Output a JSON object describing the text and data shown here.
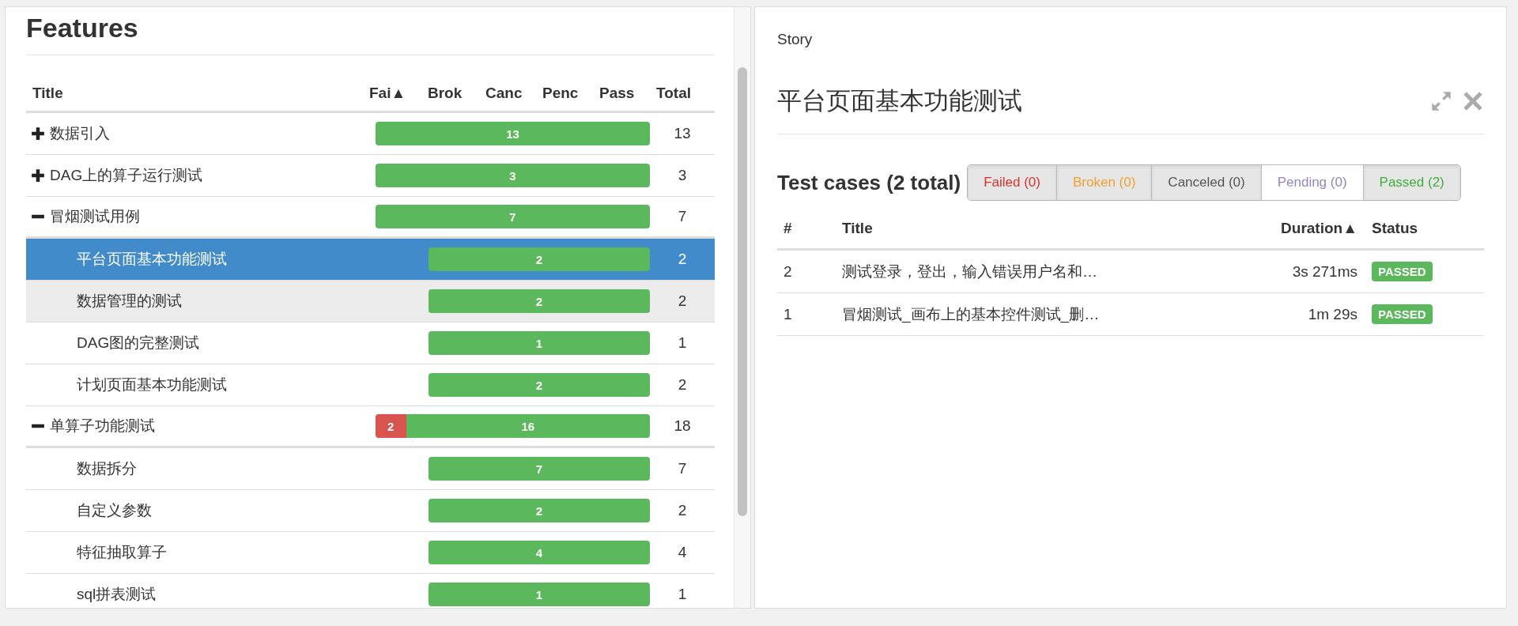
{
  "features": {
    "title": "Features",
    "columns": [
      "Title",
      "Fai▲",
      "Brok",
      "Canc",
      "Penc",
      "Pass",
      "Total"
    ],
    "rows": [
      {
        "title": "数据引入",
        "expanded": false,
        "selected": false,
        "highlighted": false,
        "segments": [
          {
            "kind": "passed",
            "count": "13"
          }
        ],
        "total": "13",
        "children": []
      },
      {
        "title": "DAG上的算子运行测试",
        "expanded": false,
        "selected": false,
        "highlighted": false,
        "segments": [
          {
            "kind": "passed",
            "count": "3"
          }
        ],
        "total": "3",
        "children": []
      },
      {
        "title": "冒烟测试用例",
        "expanded": true,
        "selected": false,
        "highlighted": false,
        "segments": [
          {
            "kind": "passed",
            "count": "7"
          }
        ],
        "total": "7",
        "children": [
          {
            "title": "平台页面基本功能测试",
            "selected": true,
            "highlighted": false,
            "segments": [
              {
                "kind": "passed",
                "count": "2"
              }
            ],
            "total": "2"
          },
          {
            "title": "数据管理的测试",
            "selected": false,
            "highlighted": true,
            "segments": [
              {
                "kind": "passed",
                "count": "2"
              }
            ],
            "total": "2"
          },
          {
            "title": "DAG图的完整测试",
            "selected": false,
            "highlighted": false,
            "segments": [
              {
                "kind": "passed",
                "count": "1"
              }
            ],
            "total": "1"
          },
          {
            "title": "计划页面基本功能测试",
            "selected": false,
            "highlighted": false,
            "segments": [
              {
                "kind": "passed",
                "count": "2"
              }
            ],
            "total": "2"
          }
        ]
      },
      {
        "title": "单算子功能测试",
        "expanded": true,
        "selected": false,
        "highlighted": false,
        "segments": [
          {
            "kind": "failed",
            "count": "2"
          },
          {
            "kind": "passed",
            "count": "16"
          }
        ],
        "total": "18",
        "children": [
          {
            "title": "数据拆分",
            "selected": false,
            "highlighted": false,
            "segments": [
              {
                "kind": "passed",
                "count": "7"
              }
            ],
            "total": "7"
          },
          {
            "title": "自定义参数",
            "selected": false,
            "highlighted": false,
            "segments": [
              {
                "kind": "passed",
                "count": "2"
              }
            ],
            "total": "2"
          },
          {
            "title": "特征抽取算子",
            "selected": false,
            "highlighted": false,
            "segments": [
              {
                "kind": "passed",
                "count": "4"
              }
            ],
            "total": "4"
          },
          {
            "title": "sql拼表测试",
            "selected": false,
            "highlighted": false,
            "segments": [
              {
                "kind": "passed",
                "count": "1"
              }
            ],
            "total": "1"
          }
        ]
      }
    ]
  },
  "story": {
    "label": "Story",
    "title": "平台页面基本功能测试",
    "cases_heading": "Test cases (2 total)",
    "filters": [
      {
        "kind": "failed",
        "label": "Failed (0)",
        "selected": true
      },
      {
        "kind": "broken",
        "label": "Broken (0)",
        "selected": true
      },
      {
        "kind": "canceled",
        "label": "Canceled (0)",
        "selected": true
      },
      {
        "kind": "pending",
        "label": "Pending (0)",
        "selected": false
      },
      {
        "kind": "passed",
        "label": "Passed (2)",
        "selected": true
      }
    ],
    "columns": [
      "#",
      "Title",
      "Duration▲",
      "Status"
    ],
    "cases": [
      {
        "number": "2",
        "title": "测试登录，登出，输入错误用户名和…",
        "duration": "3s 271ms",
        "status": {
          "kind": "passed",
          "label": "PASSED"
        }
      },
      {
        "number": "1",
        "title": "冒烟测试_画布上的基本控件测试_删…",
        "duration": "1m 29s",
        "status": {
          "kind": "passed",
          "label": "PASSED"
        }
      }
    ]
  }
}
